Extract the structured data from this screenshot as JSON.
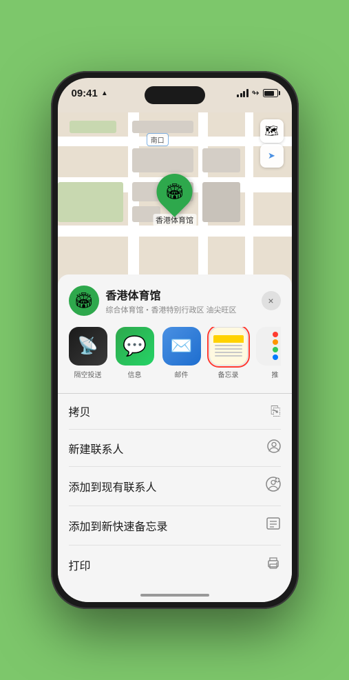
{
  "status_bar": {
    "time": "09:41",
    "location_arrow": "▲"
  },
  "map": {
    "location_label": "南口",
    "pin_emoji": "🏟",
    "place_name": "香港体育馆"
  },
  "map_controls": {
    "map_btn": "🗺",
    "location_btn": "➤"
  },
  "bottom_sheet": {
    "place_name": "香港体育馆",
    "subtitle": "综合体育馆・香港特别行政区 油尖旺区",
    "close_label": "×"
  },
  "share_items": [
    {
      "id": "airdrop",
      "label": "隔空投送",
      "emoji": "📡",
      "class": "airdrop"
    },
    {
      "id": "messages",
      "label": "信息",
      "emoji": "💬",
      "class": "messages"
    },
    {
      "id": "mail",
      "label": "邮件",
      "emoji": "✉️",
      "class": "mail"
    },
    {
      "id": "notes",
      "label": "备忘录",
      "emoji": "notes",
      "class": "notes notes-selected"
    },
    {
      "id": "more",
      "label": "推",
      "emoji": "•••",
      "class": "more"
    }
  ],
  "actions": [
    {
      "id": "copy",
      "label": "拷贝",
      "icon": "⎘"
    },
    {
      "id": "new-contact",
      "label": "新建联系人",
      "icon": "👤"
    },
    {
      "id": "add-existing",
      "label": "添加到现有联系人",
      "icon": "👤+"
    },
    {
      "id": "add-notes",
      "label": "添加到新快速备忘录",
      "icon": "⊡"
    },
    {
      "id": "print",
      "label": "打印",
      "icon": "🖨"
    }
  ]
}
